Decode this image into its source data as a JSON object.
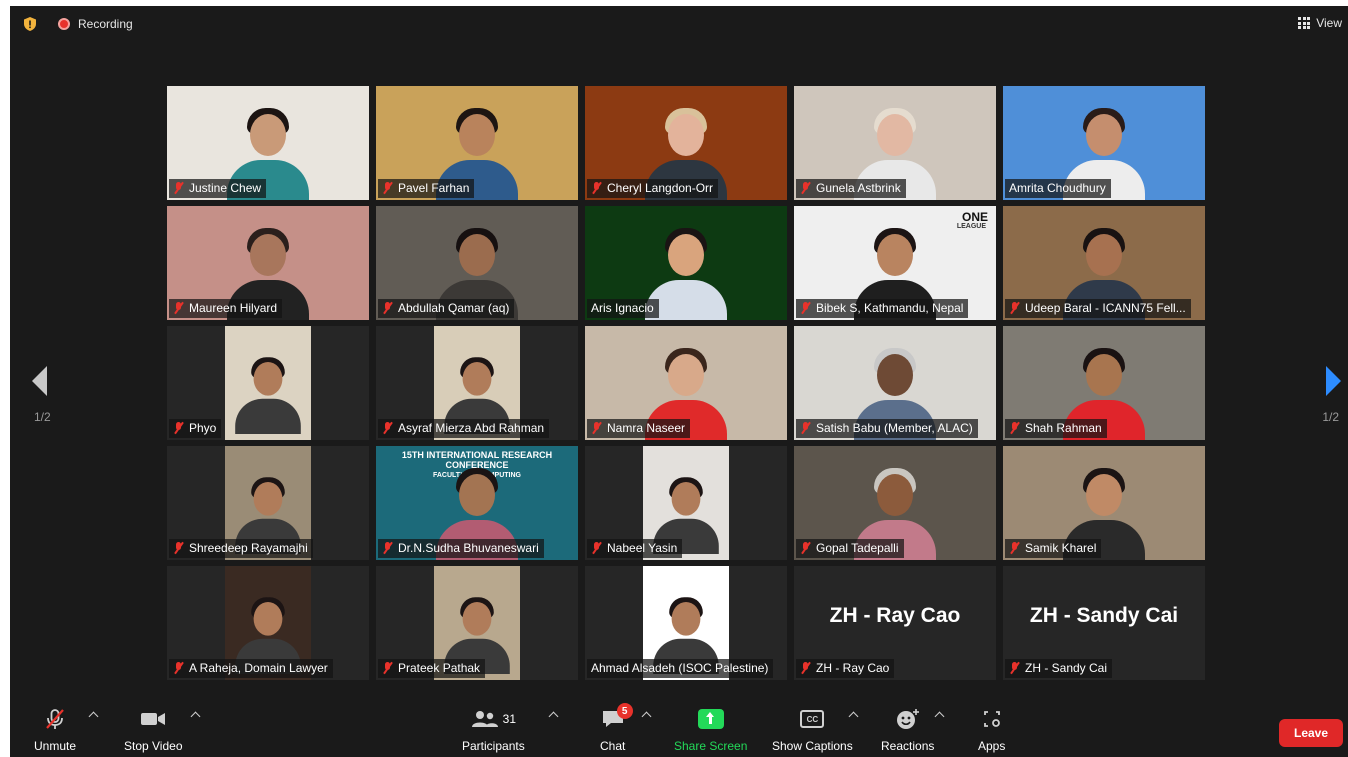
{
  "topbar": {
    "recording_label": "Recording",
    "view_label": "View",
    "shield_color": "#f2b33d"
  },
  "pager": {
    "left": "1/2",
    "right": "1/2"
  },
  "participants": [
    {
      "name": "Justine Chew",
      "muted": true,
      "bg": "#e9e5de",
      "skin": "#c99a78",
      "hair": "#1c1412",
      "shirt": "#2a8a8d"
    },
    {
      "name": "Pavel Farhan",
      "muted": true,
      "bg": "#c9a25a",
      "skin": "#b9835c",
      "hair": "#1d1512",
      "shirt": "#2e5b8c"
    },
    {
      "name": "Cheryl Langdon-Orr",
      "muted": true,
      "bg": "#8c3a12",
      "skin": "#e3b39b",
      "hair": "#d9c19a",
      "shirt": "#2d3640"
    },
    {
      "name": "Gunela Astbrink",
      "muted": true,
      "bg": "#cfc6bc",
      "skin": "#e2b8a3",
      "hair": "#e5dccf",
      "shirt": "#e8e8e8"
    },
    {
      "name": "Amrita Choudhury",
      "muted": false,
      "active": true,
      "bg": "#4f8fd8",
      "skin": "#c58e6e",
      "hair": "#2a1c18",
      "shirt": "#ededed"
    },
    {
      "name": "Maureen Hilyard",
      "muted": true,
      "bg": "#c59088",
      "skin": "#a8765c",
      "hair": "#2a1f1c",
      "shirt": "#222"
    },
    {
      "name": "Abdullah Qamar (aq)",
      "muted": true,
      "bg": "#615c55",
      "skin": "#9b6c4e",
      "hair": "#161010",
      "shirt": "#3c3936"
    },
    {
      "name": "Aris Ignacio",
      "muted": false,
      "bg": "#0d3a12",
      "skin": "#d9a47d",
      "hair": "#1a1414",
      "shirt": "#d5dde8"
    },
    {
      "name": "Bibek S, Kathmandu, Nepal",
      "muted": true,
      "bg": "#efefef",
      "skin": "#b98460",
      "hair": "#1c1414",
      "shirt": "#1f1f1f",
      "overlay_text": "ONE",
      "overlay_sub": "LEAGUE"
    },
    {
      "name": "Udeep Baral - ICANN75 Fell...",
      "muted": true,
      "bg": "#8c6b4a",
      "skin": "#a77150",
      "hair": "#181212",
      "shirt": "#2f3a4a"
    },
    {
      "name": "Phyo",
      "muted": true,
      "bg": "#262626",
      "still": true,
      "still_color": "#dcd3c2"
    },
    {
      "name": "Asyraf Mierza Abd Rahman",
      "muted": true,
      "bg": "#262626",
      "still": true,
      "still_color": "#d8cdb8"
    },
    {
      "name": "Namra Naseer",
      "muted": true,
      "bg": "#c7b9a8",
      "skin": "#d8a98a",
      "hair": "#3a261c",
      "shirt": "#e02a2a"
    },
    {
      "name": "Satish Babu (Member, ALAC)",
      "muted": true,
      "bg": "#d9d7d2",
      "skin": "#6e4a35",
      "hair": "#c8c8c8",
      "shirt": "#5b6f8c"
    },
    {
      "name": "Shah Rahman",
      "muted": true,
      "bg": "#7f7b73",
      "skin": "#a8754f",
      "hair": "#1a1212",
      "shirt": "#e0252b"
    },
    {
      "name": "Shreedeep Rayamajhi",
      "muted": true,
      "bg": "#262626",
      "still": true,
      "still_color": "#9a8c76"
    },
    {
      "name": "Dr.N.Sudha Bhuvaneswari",
      "muted": true,
      "bg": "#1c6a7a",
      "skin": "#a37452",
      "hair": "#1a1414",
      "shirt": "#b25c72",
      "overlay_text": "15TH INTERNATIONAL RESEARCH CONFERENCE",
      "overlay_sub": "FACULTY OF COMPUTING"
    },
    {
      "name": "Nabeel Yasin",
      "muted": true,
      "bg": "#262626",
      "still": true,
      "still_color": "#e3e0dc"
    },
    {
      "name": "Gopal Tadepalli",
      "muted": true,
      "bg": "#5c554c",
      "skin": "#8c5b3c",
      "hair": "#c9c6c0",
      "shirt": "#c27a8a"
    },
    {
      "name": "Samik Kharel",
      "muted": true,
      "bg": "#9c8a74",
      "skin": "#c08a66",
      "hair": "#1b1414",
      "shirt": "#2a2a2a"
    },
    {
      "name": "A Raheja, Domain Lawyer",
      "muted": true,
      "bg": "#262626",
      "still": true,
      "still_color": "#3a2a22"
    },
    {
      "name": "Prateek Pathak",
      "muted": true,
      "bg": "#262626",
      "still": true,
      "still_color": "#b8a88e"
    },
    {
      "name": "Ahmad Alsadeh (ISOC Palestine)",
      "muted": false,
      "bg": "#262626",
      "still": true,
      "still_color": "#ffffff"
    },
    {
      "name": "ZH - Ray Cao",
      "muted": true,
      "bg": "#262626",
      "big_name": "ZH - Ray Cao"
    },
    {
      "name": "ZH - Sandy Cai",
      "muted": true,
      "bg": "#262626",
      "big_name": "ZH - Sandy Cai"
    }
  ],
  "toolbar": {
    "unmute": "Unmute",
    "stop_video": "Stop Video",
    "participants": "Participants",
    "participants_count": "31",
    "chat": "Chat",
    "chat_badge": "5",
    "share_screen": "Share Screen",
    "show_captions": "Show Captions",
    "captions_icon_text": "CC",
    "reactions": "Reactions",
    "apps": "Apps",
    "leave": "Leave",
    "share_color": "#23d959",
    "leave_color": "#e02828"
  }
}
